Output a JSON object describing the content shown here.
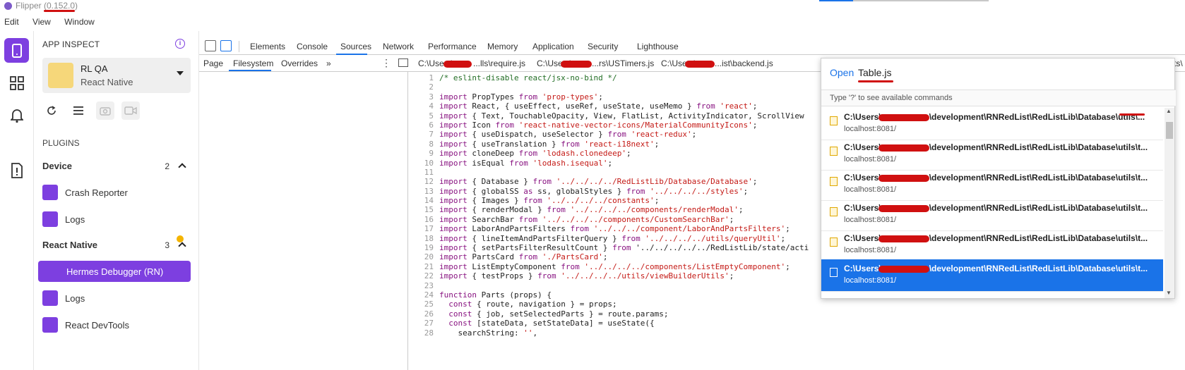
{
  "window": {
    "title": "Flipper (0.152.0)"
  },
  "menu": [
    "Edit",
    "View",
    "Window"
  ],
  "sidebar": {
    "header": "APP INSPECT",
    "device": {
      "name": "RL QA",
      "platform": "React Native"
    },
    "plugins_label": "PLUGINS",
    "sections": [
      {
        "title": "Device",
        "count": "2",
        "items": [
          "Crash Reporter",
          "Logs"
        ]
      },
      {
        "title": "React Native",
        "count": "3",
        "items": [
          "Hermes Debugger (RN)",
          "Logs",
          "React DevTools"
        ]
      }
    ]
  },
  "devtools": {
    "tabs": [
      "Elements",
      "Console",
      "Sources",
      "Network",
      "Performance",
      "Memory",
      "Application",
      "Security",
      "Lighthouse"
    ],
    "active_tab": "Sources",
    "sub_tabs": [
      "Page",
      "Filesystem",
      "Overrides"
    ],
    "sub_more": "»",
    "active_sub_tab": "Filesystem",
    "file_tabs": [
      "C:\\Users\\",
      "...lls\\require.js",
      "C:\\Users\\",
      "...rs\\USTimers.js",
      "C:\\Users\\",
      "...ist\\backend.js",
      "ts\\"
    ],
    "code_lines": [
      "/* eslint-disable react/jsx-no-bind */",
      "",
      "import PropTypes from 'prop-types';",
      "import React, { useEffect, useRef, useState, useMemo } from 'react';",
      "import { Text, TouchableOpacity, View, FlatList, ActivityIndicator, ScrollView",
      "import Icon from 'react-native-vector-icons/MaterialCommunityIcons';",
      "import { useDispatch, useSelector } from 'react-redux';",
      "import { useTranslation } from 'react-i18next';",
      "import cloneDeep from 'lodash.clonedeep';",
      "import isEqual from 'lodash.isequal';",
      "",
      "import { Database } from '../../../../RedListLib/Database/Database';",
      "import { globalSS as ss, globalStyles } from '../../../../styles';",
      "import { Images } from '../../../../constants';",
      "import { renderModal } from '../../../../components/renderModal';",
      "import SearchBar from '../../../../components/CustomSearchBar';",
      "import LaborAndPartsFilters from '../../../component/LaborAndPartsFilters';",
      "import { lineItemAndPartsFilterQuery } from '../../../../utils/queryUtil';",
      "import { setPartsFilterResultCount } from '../../../../../RedListLib/state/acti",
      "import PartsCard from './PartsCard';",
      "import ListEmptyComponent from '../../../../components/ListEmptyComponent';",
      "import { testProps } from '../../../../utils/viewBuilderUtils';",
      "",
      "function Parts (props) {",
      "  const { route, navigation } = props;",
      "  const { job, setSelectedParts } = route.params;",
      "  const [stateData, setStateData] = useState({",
      "    searchString: '',"
    ]
  },
  "palette": {
    "prefix": "Open",
    "query": "Table.js",
    "hint": "Type '?' to see available commands",
    "results": [
      {
        "path_start": "C:\\Users\\",
        "path_end": "\\development\\RNRedList\\RedListLib\\Database\\utils\\...",
        "host": "localhost:8081/"
      },
      {
        "path_start": "C:\\Users\\",
        "path_end": "\\development\\RNRedList\\RedListLib\\Database\\utils\\t...",
        "host": "localhost:8081/"
      },
      {
        "path_start": "C:\\Users\\",
        "path_end": "\\development\\RNRedList\\RedListLib\\Database\\utils\\t...",
        "host": "localhost:8081/"
      },
      {
        "path_start": "C:\\Users\\",
        "path_end": "\\development\\RNRedList\\RedListLib\\Database\\utils\\t...",
        "host": "localhost:8081/"
      },
      {
        "path_start": "C:\\Users\\",
        "path_end": "\\development\\RNRedList\\RedListLib\\Database\\utils\\t...",
        "host": "localhost:8081/"
      },
      {
        "path_start": "C:\\Users\\",
        "path_end": "\\development\\RNRedList\\RedListLib\\Database\\utils\\t...",
        "host": "localhost:8081/"
      }
    ],
    "selected_index": 5
  },
  "colors": {
    "accent": "#7d3fe0",
    "selection": "#1a73e8",
    "redaction": "#d01010",
    "badge": "#f4b400"
  }
}
